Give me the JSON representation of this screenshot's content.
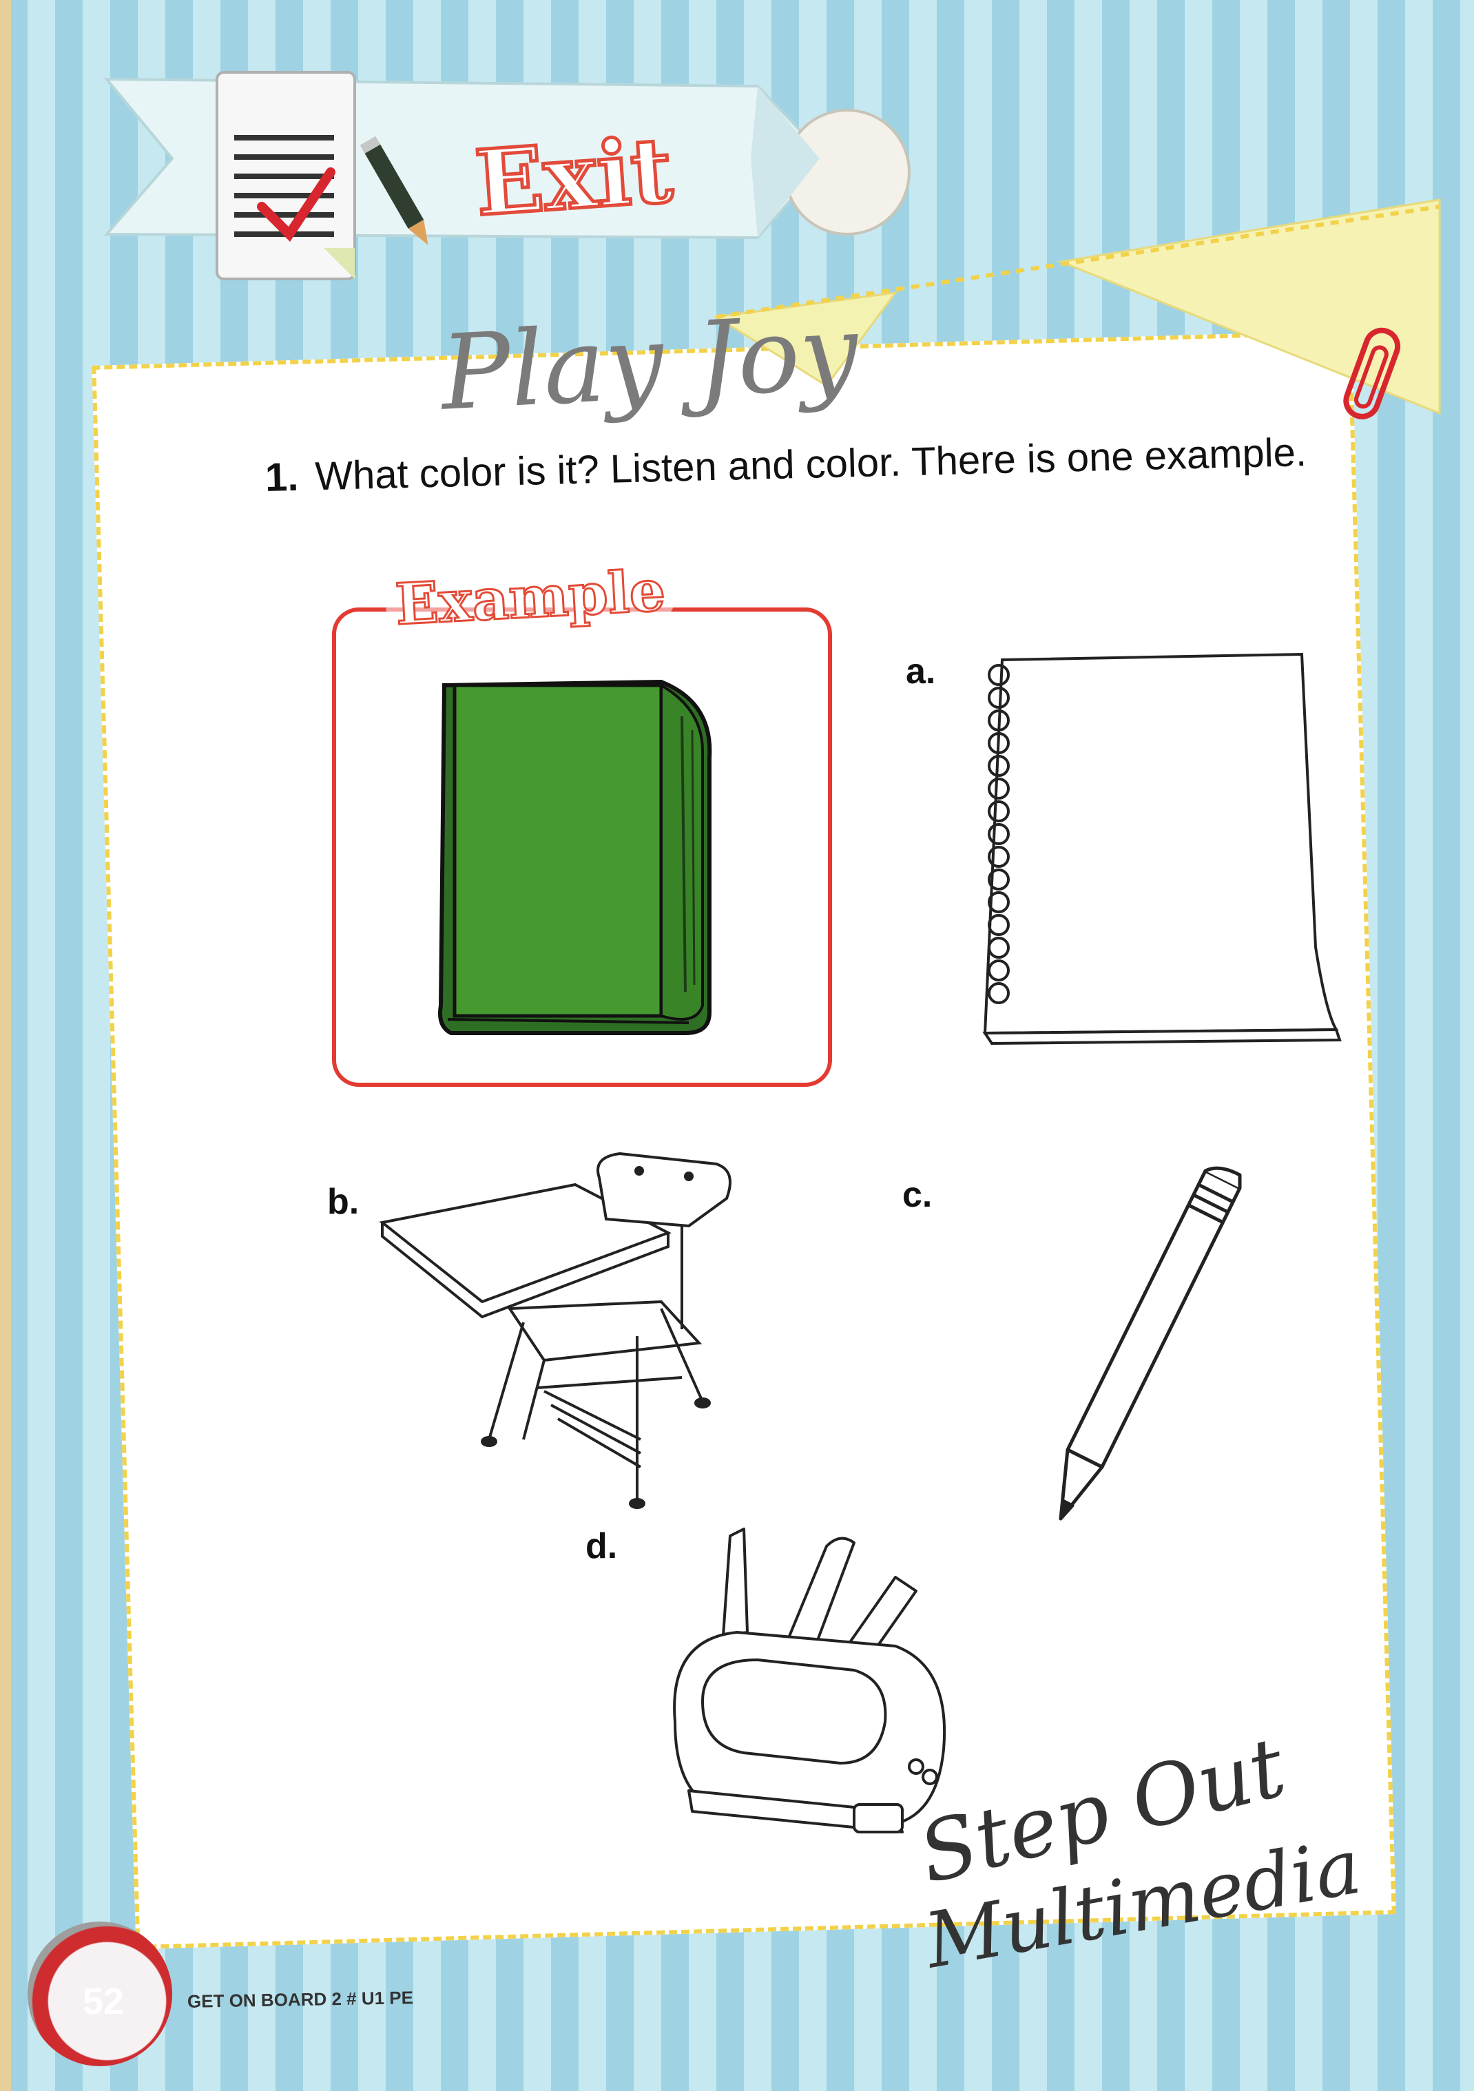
{
  "header": {
    "banner_title": "Exit"
  },
  "handwriting": {
    "top": "Play Joy",
    "bottom_line1": "Step Out",
    "bottom_line2": "Multimedia"
  },
  "question": {
    "number": "1.",
    "text": "What color is it? Listen and color. There is one example."
  },
  "example": {
    "badge": "Example",
    "book_color": "#3f8f2c"
  },
  "items": {
    "a": {
      "label": "a.",
      "object": "spiral notebook"
    },
    "b": {
      "label": "b.",
      "object": "school desk"
    },
    "c": {
      "label": "c.",
      "object": "pencil"
    },
    "d": {
      "label": "d.",
      "object": "pencil case"
    }
  },
  "footer": {
    "page_number": "52",
    "book_title": "GET ON BOARD 2 # U1 PE"
  },
  "colors": {
    "stripe_dark": "#9fd3e3",
    "stripe_light": "#c6e8f1",
    "dash_border": "#f2d24a",
    "accent_red": "#e44a36",
    "book_green": "#3f8f2c"
  },
  "icons": [
    "checklist-icon",
    "pencil-icon",
    "paperclip-icon"
  ]
}
